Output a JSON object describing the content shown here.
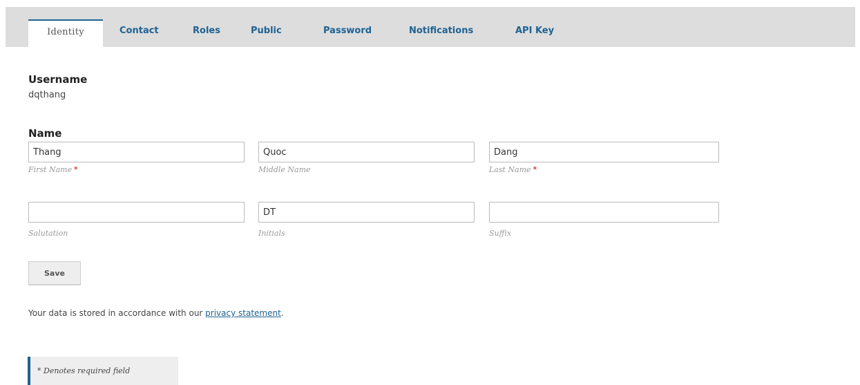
{
  "tabs": [
    {
      "label": "Identity",
      "active": true
    },
    {
      "label": "Contact"
    },
    {
      "label": "Roles"
    },
    {
      "label": "Public"
    },
    {
      "label": "Password"
    },
    {
      "label": "Notifications"
    },
    {
      "label": "API Key"
    }
  ],
  "username": {
    "label": "Username",
    "value": "dqthang"
  },
  "name": {
    "label": "Name",
    "first_name": {
      "value": "Thang",
      "label": "First Name"
    },
    "middle_name": {
      "value": "Quoc",
      "label": "Middle Name"
    },
    "last_name": {
      "value": "Dang",
      "label": "Last Name"
    },
    "salutation": {
      "value": "",
      "label": "Salutation"
    },
    "initials": {
      "value": "DT",
      "label": "Initials"
    },
    "suffix": {
      "value": "",
      "label": "Suffix"
    },
    "required_marker": "*"
  },
  "save_label": "Save",
  "privacy": {
    "prefix": "Your data is stored in accordance with our ",
    "link": "privacy statement",
    "suffix": "."
  },
  "required_notice": "* Denotes required field",
  "colors": {
    "accent": "#1e6292",
    "required": "#d00000",
    "tabbar": "#dddddd"
  }
}
